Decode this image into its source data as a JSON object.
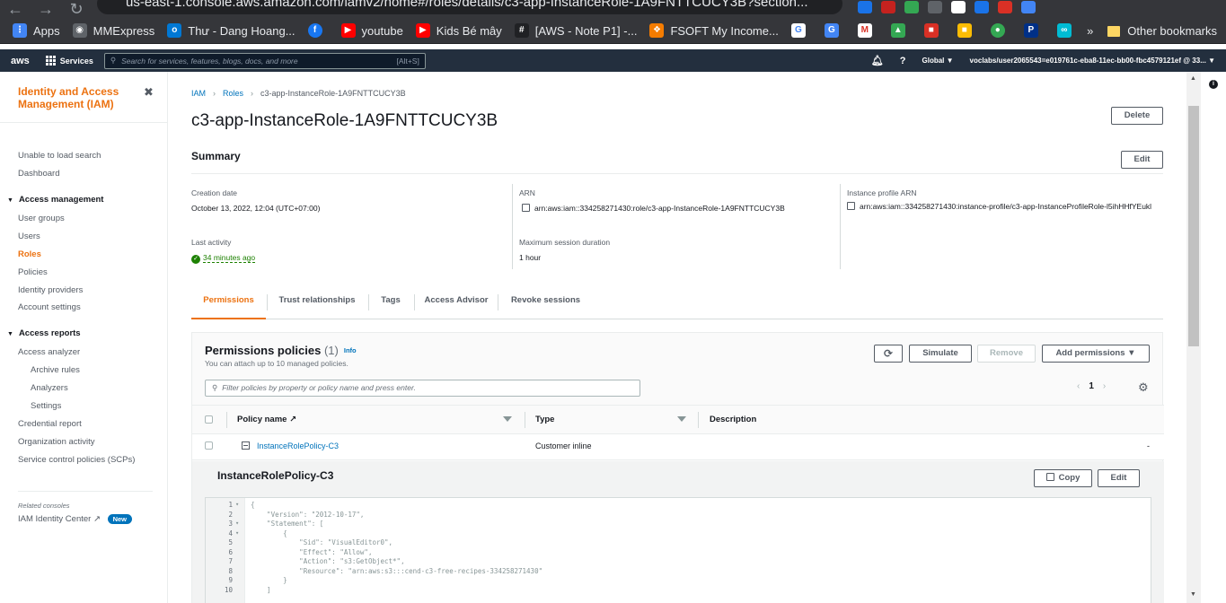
{
  "browser": {
    "url": "us-east-1.console.aws.amazon.com/iamv2/home#/roles/details/c3-app-InstanceRole-1A9FNTTCUCY3B?section...",
    "bookmarks": [
      {
        "label": "Apps",
        "icon": "apps-grid-icon",
        "color": "#4285f4"
      },
      {
        "label": "MMExpress",
        "icon": "globe-icon",
        "color": "#5f6368"
      },
      {
        "label": "Thư - Dang Hoang...",
        "icon": "outlook-icon",
        "color": "#0078d4"
      },
      {
        "label": "",
        "icon": "facebook-icon",
        "color": "#1877f2"
      },
      {
        "label": "youtube",
        "icon": "youtube-icon",
        "color": "#ff0000"
      },
      {
        "label": "Kids Bé mây",
        "icon": "youtube-icon",
        "color": "#ff0000"
      },
      {
        "label": "[AWS - Note P1] -...",
        "icon": "notion-icon",
        "color": "#202124"
      },
      {
        "label": "FSOFT My Income...",
        "icon": "fsoft-icon",
        "color": "#f57c00"
      }
    ],
    "other_bookmarks": "Other bookmarks",
    "more": "»"
  },
  "aws_header": {
    "logo": "aws",
    "services": "Services",
    "search_placeholder": "Search for services, features, blogs, docs, and more",
    "search_shortcut": "[Alt+S]",
    "region": "Global ▼",
    "account": "voclabs/user2065543=e019761c-eba8-11ec-bb00-fbc4579121ef @ 33... ▼"
  },
  "sidebar": {
    "title": "Identity and Access Management (IAM)",
    "close": "✖",
    "top_items": [
      "Unable to load search",
      "Dashboard"
    ],
    "access_management": {
      "label": "Access management",
      "items": [
        "User groups",
        "Users",
        "Roles",
        "Policies",
        "Identity providers",
        "Account settings"
      ]
    },
    "access_reports": {
      "label": "Access reports",
      "items": [
        "Access analyzer",
        "Archive rules",
        "Analyzers",
        "Settings",
        "Credential report",
        "Organization activity",
        "Service control policies (SCPs)"
      ]
    },
    "related_label": "Related consoles",
    "identity_center": "IAM Identity Center",
    "new_badge": "New"
  },
  "breadcrumb": {
    "iam": "IAM",
    "roles": "Roles",
    "current": "c3-app-InstanceRole-1A9FNTTCUCY3B"
  },
  "page": {
    "title": "c3-app-InstanceRole-1A9FNTTCUCY3B",
    "delete": "Delete",
    "summary_title": "Summary",
    "edit": "Edit"
  },
  "summary": {
    "creation_date_label": "Creation date",
    "creation_date": "October 13, 2022, 12:04 (UTC+07:00)",
    "last_activity_label": "Last activity",
    "last_activity": "34 minutes ago",
    "arn_label": "ARN",
    "arn": "arn:aws:iam::334258271430:role/c3-app-InstanceRole-1A9FNTTCUCY3B",
    "max_session_label": "Maximum session duration",
    "max_session": "1 hour",
    "instance_profile_label": "Instance profile ARN",
    "instance_profile_arn": "arn:aws:iam::334258271430:instance-profile/c3-app-InstanceProfileRole-l5ihHHfYEukl"
  },
  "tabs": [
    "Permissions",
    "Trust relationships",
    "Tags",
    "Access Advisor",
    "Revoke sessions"
  ],
  "permissions": {
    "title": "Permissions policies",
    "count": "(1)",
    "info": "Info",
    "subtitle": "You can attach up to 10 managed policies.",
    "refresh": "⟳",
    "simulate": "Simulate",
    "remove": "Remove",
    "add": "Add permissions ▼",
    "filter_placeholder": "Filter policies by property or policy name and press enter.",
    "page": "1",
    "prev": "‹",
    "next": "›",
    "columns": {
      "name": "Policy name",
      "type": "Type",
      "description": "Description"
    },
    "row": {
      "name": "InstanceRolePolicy-C3",
      "type": "Customer inline",
      "description": "-"
    }
  },
  "policy_detail": {
    "title": "InstanceRolePolicy-C3",
    "copy": "Copy",
    "edit": "Edit",
    "lines": [
      {
        "n": "1",
        "fold": "▾",
        "text": "{"
      },
      {
        "n": "2",
        "fold": "",
        "text": "    \"Version\": \"2012-10-17\","
      },
      {
        "n": "3",
        "fold": "▾",
        "text": "    \"Statement\": ["
      },
      {
        "n": "4",
        "fold": "▾",
        "text": "        {"
      },
      {
        "n": "5",
        "fold": "",
        "text": "            \"Sid\": \"VisualEditor0\","
      },
      {
        "n": "6",
        "fold": "",
        "text": "            \"Effect\": \"Allow\","
      },
      {
        "n": "7",
        "fold": "",
        "text": "            \"Action\": \"s3:GetObject*\","
      },
      {
        "n": "8",
        "fold": "",
        "text": "            \"Resource\": \"arn:aws:s3:::cend-c3-free-recipes-334258271430\""
      },
      {
        "n": "9",
        "fold": "",
        "text": "        }"
      },
      {
        "n": "10",
        "fold": "",
        "text": "    ]"
      }
    ]
  }
}
